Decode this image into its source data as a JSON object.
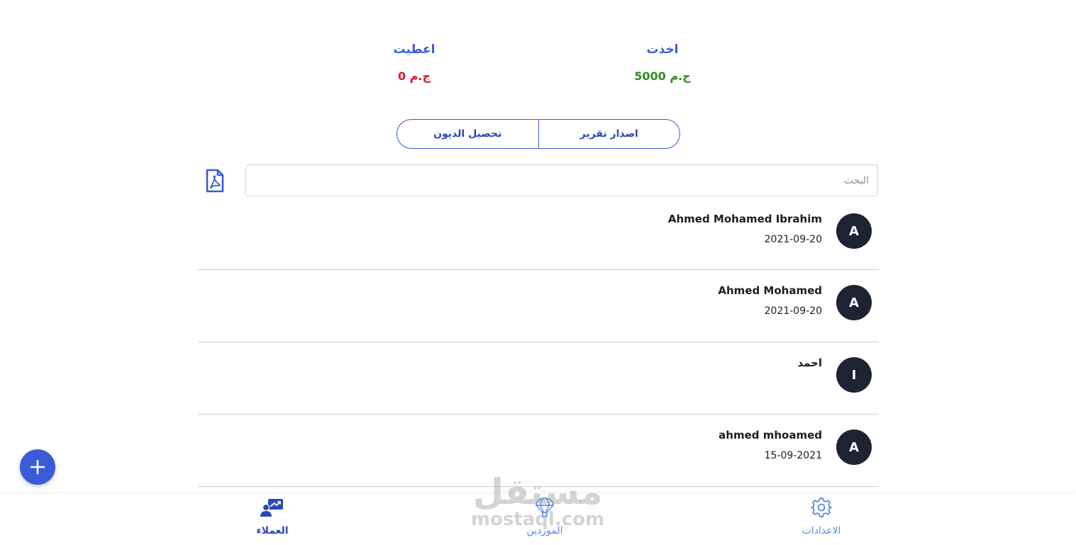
{
  "summary": {
    "gave_label": "اعطيت",
    "gave_value": "0 ج.م",
    "took_label": "اخذت",
    "took_value": "5000 ج.م"
  },
  "actions": {
    "collect_debts": "تحصيل الديون",
    "issue_report": "اصدار تقرير"
  },
  "search": {
    "placeholder": "البحث",
    "pdf_icon": "pdf-icon"
  },
  "customers": [
    {
      "initial": "A",
      "name": "Ahmed Mohamed Ibrahim",
      "date": "2021-09-20"
    },
    {
      "initial": "A",
      "name": "Ahmed Mohamed",
      "date": "2021-09-20"
    },
    {
      "initial": "I",
      "name": "احمد",
      "date": ""
    },
    {
      "initial": "A",
      "name": "ahmed mhoamed",
      "date": "15-09-2021"
    }
  ],
  "fab": {
    "icon": "plus-icon"
  },
  "nav": {
    "clients": "العملاء",
    "suppliers": "الموردين",
    "settings": "الاعدادات"
  },
  "watermark": {
    "arabic": "مستقل",
    "latin": "mostaql.com"
  },
  "colors": {
    "primary": "#3a5bd9",
    "negative": "#e0162b",
    "positive": "#2e8b1e",
    "avatar": "#1e2333"
  }
}
